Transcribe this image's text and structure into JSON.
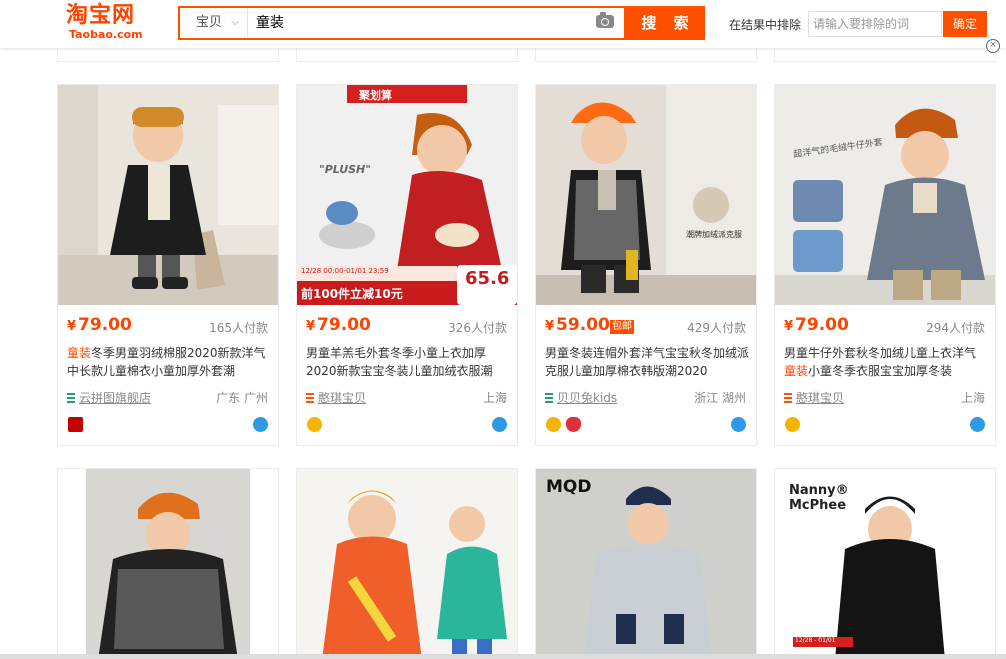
{
  "header": {
    "logo_cn": "淘宝网",
    "logo_en": "Taobao.com",
    "scope": "宝贝",
    "query": "童装",
    "search_button": "搜 索",
    "exclude_label": "在结果中排除",
    "exclude_placeholder": "请输入要排除的词",
    "confirm_button": "确定",
    "close": "×"
  },
  "products": [
    {
      "price": "79.00",
      "sold": "165人付款",
      "title_highlight": "童装",
      "title_rest": "冬季男童羽绒棉服2020新款洋气中长款儿童棉衣小童加厚外套潮",
      "shop": "云拼图旗舰店",
      "location": "广东 广州",
      "free_shipping": ""
    },
    {
      "price": "79.00",
      "sold": "326人付款",
      "title_highlight": "",
      "title_rest": "男童羊羔毛外套冬季小童上衣加厚2020新款宝宝冬装儿童加绒衣服潮",
      "shop": "憨琪宝贝",
      "location": "上海",
      "free_shipping": "",
      "img_banner": "聚划算",
      "img_label": "\"PLUSH\"",
      "img_promo": "前100件立减10元",
      "img_price": "65.6",
      "img_date": "12/28 00:00-01/01 23:59"
    },
    {
      "price": "59.00",
      "sold": "429人付款",
      "title_highlight": "",
      "title_rest": "男童冬装连帽外套洋气宝宝秋冬加绒派克服儿童加厚棉衣韩版潮2020",
      "shop": "贝贝兔kids",
      "location": "浙江 湖州",
      "free_shipping": "包邮",
      "img_label": "潮牌加绒派克服"
    },
    {
      "price": "79.00",
      "sold": "294人付款",
      "title_highlight": "童装",
      "title_pre": "男童牛仔外套秋冬加绒儿童上衣洋气",
      "title_rest": "小童冬季衣服宝宝加厚冬装",
      "shop": "憨琪宝贝",
      "location": "上海",
      "free_shipping": "",
      "img_label": "超洋气的毛绒牛仔外套"
    }
  ],
  "row2": [
    {
      "brand": ""
    },
    {
      "brand": ""
    },
    {
      "brand": "MQD"
    },
    {
      "brand": "Nanny® McPhee",
      "date": "12/28 - 01/01"
    }
  ],
  "colors": {
    "accent": "#ff5000",
    "price": "#ff4400"
  }
}
